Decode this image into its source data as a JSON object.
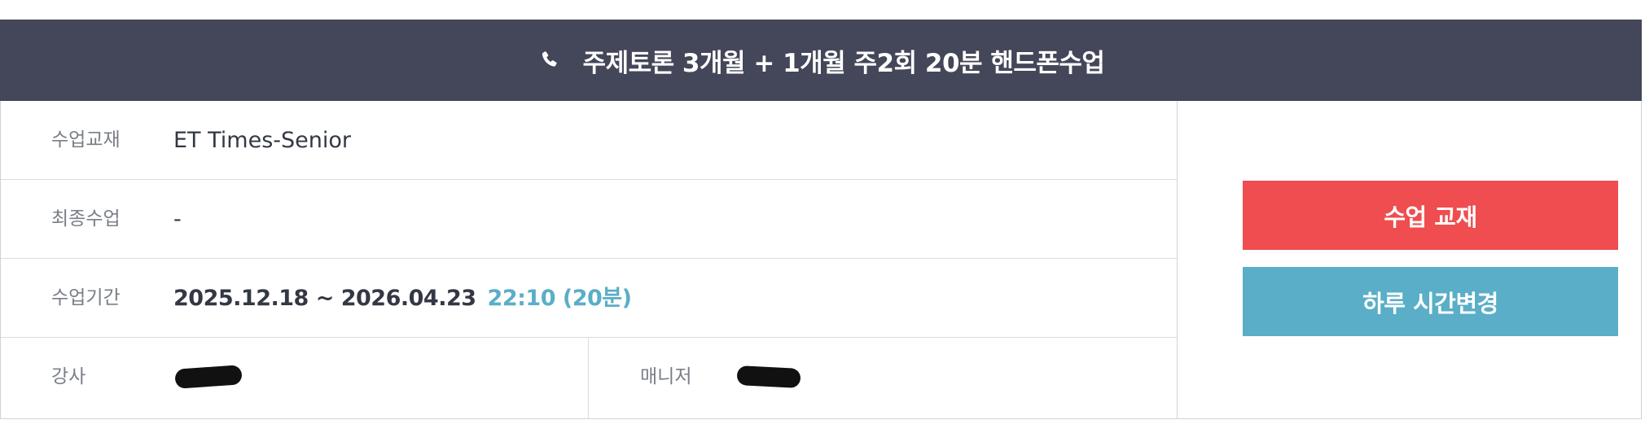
{
  "header": {
    "icon": "phone-icon",
    "title": "주제토론 3개월 + 1개월 주2회 20분 핸드폰수업",
    "background": "#444659"
  },
  "rows": {
    "textbook": {
      "label": "수업교재",
      "value": "ET Times-Senior"
    },
    "last_class": {
      "label": "최종수업",
      "value": "-"
    },
    "period": {
      "label": "수업기간",
      "dates": "2025.12.18 ~ 2026.04.23",
      "time": "22:10 (20분)"
    },
    "teacher": {
      "label": "강사"
    },
    "manager": {
      "label": "매니저"
    }
  },
  "buttons": {
    "textbook_label": "수업 교재",
    "textbook_color": "#ef4d4f",
    "reschedule_label": "하루 시간변경",
    "reschedule_color": "#5aaec7"
  }
}
